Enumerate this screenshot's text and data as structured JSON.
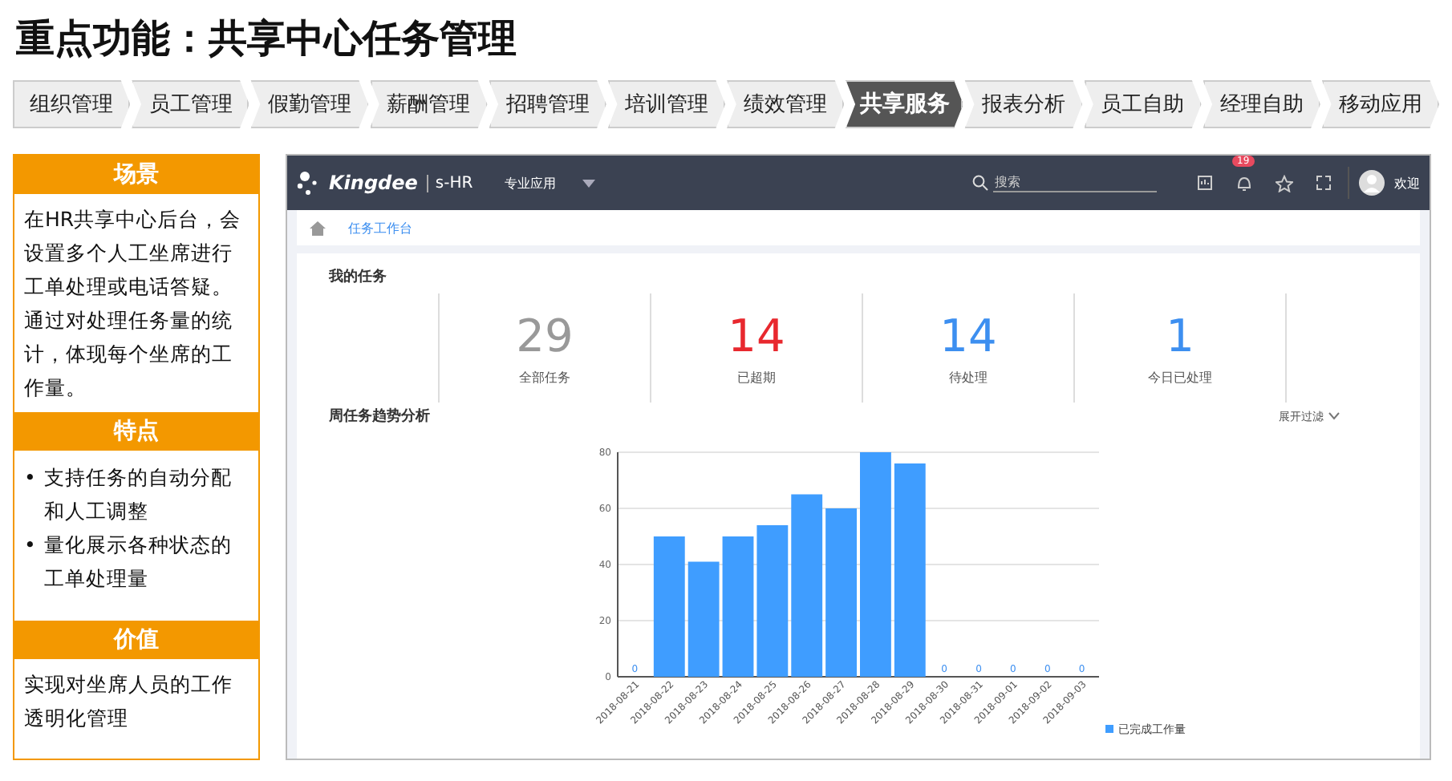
{
  "title": "重点功能：共享中心任务管理",
  "tabs": [
    {
      "label": "组织管理",
      "selected": false
    },
    {
      "label": "员工管理",
      "selected": false
    },
    {
      "label": "假勤管理",
      "selected": false
    },
    {
      "label": "薪酬管理",
      "selected": false
    },
    {
      "label": "招聘管理",
      "selected": false
    },
    {
      "label": "培训管理",
      "selected": false
    },
    {
      "label": "绩效管理",
      "selected": false
    },
    {
      "label": "共享服务",
      "selected": true
    },
    {
      "label": "报表分析",
      "selected": false
    },
    {
      "label": "员工自助",
      "selected": false
    },
    {
      "label": "经理自助",
      "selected": false
    },
    {
      "label": "移动应用",
      "selected": false
    }
  ],
  "sections": [
    {
      "heading": "场景",
      "kind": "text",
      "text": "在HR共享中心后台，会设置多个人工坐席进行工单处理或电话答疑。通过对处理任务量的统计，体现每个坐席的工作量。"
    },
    {
      "heading": "特点",
      "kind": "bullets",
      "marker": "•",
      "items": [
        "支持任务的自动分配和人工调整",
        "量化展示各种状态的工单处理量"
      ]
    },
    {
      "heading": "价值",
      "kind": "text",
      "text": "实现对坐席人员的工作透明化管理"
    }
  ],
  "app": {
    "logo": "Kingdee",
    "product": "s-HR",
    "menu": "专业应用",
    "search": {
      "placeholder": "搜索"
    },
    "notification_badge": "19",
    "user": "欢迎",
    "breadcrumb": "任务工作台",
    "tasks_title": "我的任务",
    "stats": [
      {
        "value": "29",
        "label": "全部任务",
        "color": "#999999"
      },
      {
        "value": "14",
        "label": "已超期",
        "color": "#e8282e"
      },
      {
        "value": "14",
        "label": "待处理",
        "color": "#3d8ff0"
      },
      {
        "value": "1",
        "label": "今日已处理",
        "color": "#3d8ff0"
      }
    ],
    "trend_title": "周任务趋势分析",
    "filter": "展开过滤",
    "chart_data": {
      "type": "bar",
      "categories": [
        "2018-08-21",
        "2018-08-22",
        "2018-08-23",
        "2018-08-24",
        "2018-08-25",
        "2018-08-26",
        "2018-08-27",
        "2018-08-28",
        "2018-08-29",
        "2018-08-30",
        "2018-08-31",
        "2018-09-01",
        "2018-09-02",
        "2018-09-03"
      ],
      "series": [
        {
          "name": "已完成工作量",
          "color": "#3f9dff",
          "values": [
            0,
            50,
            41,
            50,
            54,
            65,
            60,
            80,
            76,
            0,
            0,
            0,
            0,
            0
          ]
        }
      ],
      "grid": true,
      "ylim": [
        0,
        80
      ],
      "yticks": [
        0,
        20,
        40,
        60,
        80
      ],
      "value_labels": [
        "0",
        null,
        null,
        null,
        null,
        null,
        null,
        null,
        null,
        "0",
        "0",
        "0",
        "0",
        "0"
      ]
    }
  }
}
